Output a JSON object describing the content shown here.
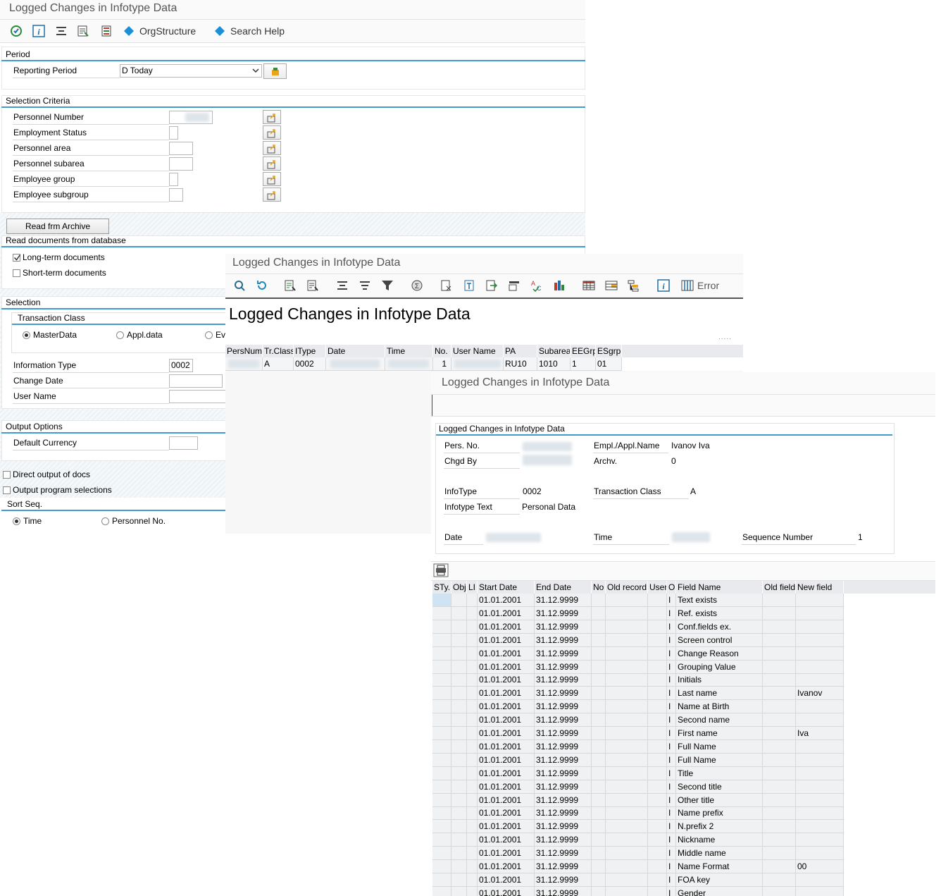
{
  "selection_screen": {
    "title": "Logged Changes in Infotype Data",
    "toolbar": {
      "orgstructure": "OrgStructure",
      "search_help": "Search Help"
    },
    "period": {
      "section": "Period",
      "reporting_period_label": "Reporting Period",
      "reporting_period_value": "D Today"
    },
    "selection_criteria": {
      "section": "Selection Criteria",
      "fields": [
        "Personnel Number",
        "Employment Status",
        "Personnel area",
        "Personnel subarea",
        "Employee group",
        "Employee subgroup"
      ]
    },
    "read_archive_button": "Read frm Archive",
    "read_db": {
      "section": "Read documents from database",
      "long_term": "Long-term documents",
      "short_term": "Short-term documents"
    },
    "selection": {
      "section": "Selection",
      "transaction_class": "Transaction Class",
      "radio_master": "MasterData",
      "radio_appl": "Appl.data",
      "radio_ev": "Ev",
      "info_type_label": "Information Type",
      "info_type_value": "0002",
      "change_date_label": "Change Date",
      "user_name_label": "User Name"
    },
    "output": {
      "section": "Output Options",
      "default_currency_label": "Default Currency",
      "direct_output": "Direct output of docs",
      "output_program": "Output program selections"
    },
    "sort": {
      "section": "Sort Seq.",
      "time": "Time",
      "personnel_no": "Personnel No."
    }
  },
  "list_screen": {
    "title": "Logged Changes in Infotype Data",
    "toolbar_error": "Error",
    "heading": "Logged Changes in Infotype Data",
    "columns": [
      "PersNum",
      "Tr.Class",
      "IType",
      "Date",
      "Time",
      "No.",
      "User Name",
      "PA",
      "Subarea",
      "EEGrp",
      "ESgrp"
    ],
    "row": {
      "trclass": "A",
      "itype": "0002",
      "no": "1",
      "pa": "RU10",
      "subarea": "1010",
      "eegrp": "1",
      "esgrp": "01"
    }
  },
  "detail_screen": {
    "title": "Logged Changes in Infotype Data",
    "group_title": "Logged Changes in Infotype Data",
    "pers_no_label": "Pers. No.",
    "chgd_by_label": "Chgd By",
    "empl_name_label": "Empl./Appl.Name",
    "empl_name_value": "Ivanov Iva",
    "archv_label": "Archv.",
    "archv_value": "0",
    "infotype_label": "InfoType",
    "infotype_value": "0002",
    "infotype_text_label": "Infotype Text",
    "infotype_text_value": "Personal Data",
    "transaction_class_label": "Transaction Class",
    "transaction_class_value": "A",
    "date_label": "Date",
    "time_label": "Time",
    "seq_label": "Sequence Number",
    "seq_value": "1",
    "columns": [
      "STy.",
      "Obj",
      "LI",
      "Start Date",
      "End Date",
      "No",
      "Old record",
      "User",
      "O",
      "Field Name",
      "Old field",
      "New field"
    ],
    "rows": [
      {
        "start": "01.01.2001",
        "end": "31.12.9999",
        "o": "I",
        "field": "Text exists",
        "new": ""
      },
      {
        "start": "01.01.2001",
        "end": "31.12.9999",
        "o": "I",
        "field": "Ref. exists",
        "new": ""
      },
      {
        "start": "01.01.2001",
        "end": "31.12.9999",
        "o": "I",
        "field": "Conf.fields ex.",
        "new": ""
      },
      {
        "start": "01.01.2001",
        "end": "31.12.9999",
        "o": "I",
        "field": "Screen control",
        "new": ""
      },
      {
        "start": "01.01.2001",
        "end": "31.12.9999",
        "o": "I",
        "field": "Change Reason",
        "new": ""
      },
      {
        "start": "01.01.2001",
        "end": "31.12.9999",
        "o": "I",
        "field": "Grouping Value",
        "new": ""
      },
      {
        "start": "01.01.2001",
        "end": "31.12.9999",
        "o": "I",
        "field": "Initials",
        "new": ""
      },
      {
        "start": "01.01.2001",
        "end": "31.12.9999",
        "o": "I",
        "field": "Last name",
        "new": "Ivanov"
      },
      {
        "start": "01.01.2001",
        "end": "31.12.9999",
        "o": "I",
        "field": "Name at Birth",
        "new": ""
      },
      {
        "start": "01.01.2001",
        "end": "31.12.9999",
        "o": "I",
        "field": "Second name",
        "new": ""
      },
      {
        "start": "01.01.2001",
        "end": "31.12.9999",
        "o": "I",
        "field": "First name",
        "new": "Iva"
      },
      {
        "start": "01.01.2001",
        "end": "31.12.9999",
        "o": "I",
        "field": "Full Name",
        "new": ""
      },
      {
        "start": "01.01.2001",
        "end": "31.12.9999",
        "o": "I",
        "field": "Full Name",
        "new": ""
      },
      {
        "start": "01.01.2001",
        "end": "31.12.9999",
        "o": "I",
        "field": "Title",
        "new": ""
      },
      {
        "start": "01.01.2001",
        "end": "31.12.9999",
        "o": "I",
        "field": "Second title",
        "new": ""
      },
      {
        "start": "01.01.2001",
        "end": "31.12.9999",
        "o": "I",
        "field": "Other title",
        "new": ""
      },
      {
        "start": "01.01.2001",
        "end": "31.12.9999",
        "o": "I",
        "field": "Name prefix",
        "new": ""
      },
      {
        "start": "01.01.2001",
        "end": "31.12.9999",
        "o": "I",
        "field": "N.prefix 2",
        "new": ""
      },
      {
        "start": "01.01.2001",
        "end": "31.12.9999",
        "o": "I",
        "field": "Nickname",
        "new": ""
      },
      {
        "start": "01.01.2001",
        "end": "31.12.9999",
        "o": "I",
        "field": "Middle name",
        "new": ""
      },
      {
        "start": "01.01.2001",
        "end": "31.12.9999",
        "o": "I",
        "field": "Name Format",
        "new": "00"
      },
      {
        "start": "01.01.2001",
        "end": "31.12.9999",
        "o": "I",
        "field": "FOA key",
        "new": ""
      },
      {
        "start": "01.01.2001",
        "end": "31.12.9999",
        "o": "I",
        "field": "Gender",
        "new": ""
      }
    ]
  }
}
